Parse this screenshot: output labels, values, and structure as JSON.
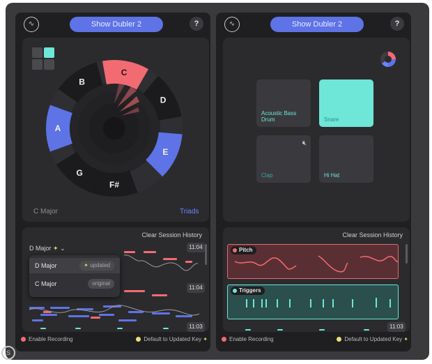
{
  "left_panel": {
    "show_button": "Show Dubler 2",
    "help": "?",
    "logo": "wave-logo-icon",
    "wheel_notes": [
      {
        "note": "C",
        "active": true
      },
      {
        "note": "D",
        "active": false
      },
      {
        "note": "E",
        "active": true
      },
      {
        "note": "F#",
        "active": false
      },
      {
        "note": "G",
        "active": false
      },
      {
        "note": "A",
        "active": true
      },
      {
        "note": "B",
        "active": false
      }
    ],
    "key_label": "C Major",
    "chord_mode": "Triads",
    "clear_history": "Clear Session History",
    "key_selector": "D Major",
    "key_options": [
      {
        "label": "D Major",
        "badge": "updated"
      },
      {
        "label": "C Major",
        "badge": "original"
      }
    ],
    "timestamps": [
      "11:04",
      "11:04",
      "11:03"
    ],
    "enable_recording": "Enable Recording",
    "default_key": "Default to Updated Key"
  },
  "right_panel": {
    "show_button": "Show Dubler 2",
    "help": "?",
    "pads": [
      {
        "label": "Acoustic Bass Drum",
        "state": "normal"
      },
      {
        "label": "Snare",
        "state": "active"
      },
      {
        "label": "Clap",
        "state": "muted"
      },
      {
        "label": "Hi Hat",
        "state": "normal"
      }
    ],
    "clear_history": "Clear Session History",
    "lanes": [
      {
        "label": "Pitch",
        "color": "#e06a73"
      },
      {
        "label": "Triggers",
        "color": "#6ee6d8"
      }
    ],
    "timestamp": "11:03",
    "enable_recording": "Enable Recording",
    "default_key": "Default to Updated Key"
  },
  "colors": {
    "accent_blue": "#5d73e6",
    "accent_red": "#f26b73",
    "accent_teal": "#6ee6d8",
    "panel_bg": "#1f1f21"
  }
}
